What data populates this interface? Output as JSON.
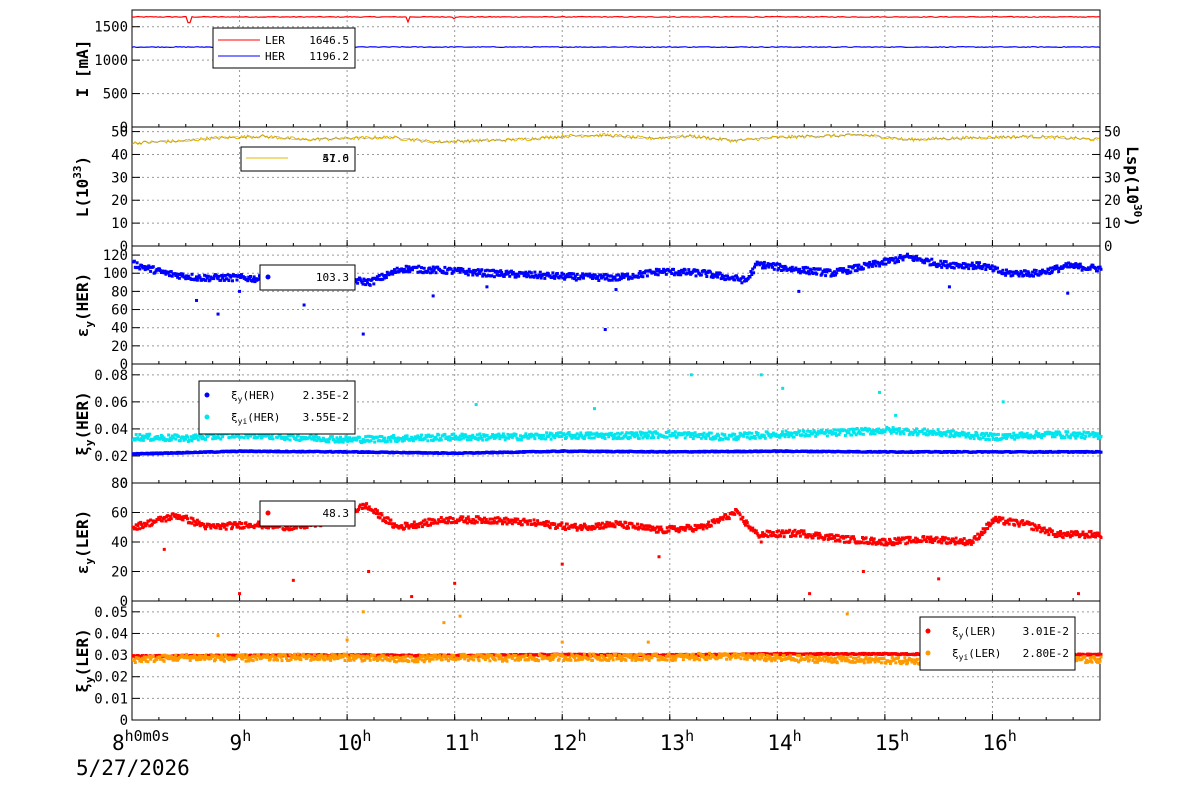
{
  "footer": {
    "date": "5/27/2026"
  },
  "x_axis": {
    "first_label": "8h0m0s",
    "ticks": [
      {
        "t": 8,
        "h": "8",
        "sup": "h0m0s"
      },
      {
        "t": 9,
        "h": "9",
        "sup": "h"
      },
      {
        "t": 10,
        "h": "10",
        "sup": "h"
      },
      {
        "t": 11,
        "h": "11",
        "sup": "h"
      },
      {
        "t": 12,
        "h": "12",
        "sup": "h"
      },
      {
        "t": 13,
        "h": "13",
        "sup": "h"
      },
      {
        "t": 14,
        "h": "14",
        "sup": "h"
      },
      {
        "t": 15,
        "h": "15",
        "sup": "h"
      },
      {
        "t": 16,
        "h": "16",
        "sup": "h"
      }
    ],
    "range_hours": [
      8.0,
      17.0
    ]
  },
  "chart_data": [
    {
      "type": "line",
      "ylabel": "I [mA]",
      "ylim": [
        0,
        1750
      ],
      "yticks": [
        0,
        500,
        1000,
        1500
      ],
      "grid": true,
      "legend_placement": "top-left",
      "series": [
        {
          "name": "LER",
          "value_text": "1646.5",
          "color": "#ff0000",
          "level": 1646.5,
          "dips": [
            {
              "t": 8.53,
              "v": 1560
            },
            {
              "t": 10.56,
              "v": 1570
            },
            {
              "t": 11.0,
              "v": 1620
            }
          ]
        },
        {
          "name": "HER",
          "value_text": "1196.2",
          "color": "#0000ff",
          "level": 1196.2,
          "dips": []
        }
      ]
    },
    {
      "type": "line",
      "ylabel": "L(10^33)",
      "ylabel_right": "Lsp(10^30)",
      "ylim": [
        0,
        52
      ],
      "yticks": [
        0,
        10,
        20,
        30,
        40,
        50
      ],
      "right_ticks": [
        0,
        10,
        20,
        30,
        40,
        50
      ],
      "grid": true,
      "legend_placement": "top-left",
      "legend_overlap_values": [
        "57.0",
        "41.6"
      ],
      "series": [
        {
          "name": "",
          "color": "#e6b800",
          "x": [
            8.0,
            8.5,
            8.7,
            9.2,
            9.6,
            10.0,
            10.4,
            10.8,
            11.2,
            11.6,
            12.0,
            12.4,
            12.8,
            13.2,
            13.6,
            14.0,
            14.4,
            14.8,
            15.2,
            15.6,
            16.0,
            16.4,
            17.0
          ],
          "y": [
            45,
            46,
            47,
            48,
            46.5,
            47,
            47.5,
            45.5,
            46,
            46.5,
            48,
            48.5,
            47,
            48,
            46,
            47.5,
            48,
            48.5,
            46.5,
            47,
            47.5,
            47.8,
            46.5
          ]
        }
      ]
    },
    {
      "type": "scatter",
      "ylabel": "εy(HER)",
      "ylim": [
        0,
        130
      ],
      "yticks": [
        0,
        20,
        40,
        60,
        80,
        100,
        120
      ],
      "grid": true,
      "legend_placement": "top-left",
      "legend_value": "103.3",
      "series": [
        {
          "name": "",
          "color": "#0000ff",
          "x": [
            8.0,
            8.3,
            8.6,
            9.0,
            9.4,
            9.8,
            10.2,
            10.5,
            10.9,
            11.3,
            11.7,
            12.1,
            12.5,
            12.9,
            13.3,
            13.7,
            13.8,
            14.1,
            14.5,
            14.9,
            15.2,
            15.5,
            15.9,
            16.1,
            16.4,
            16.7,
            17.0
          ],
          "y": [
            110,
            100,
            95,
            95,
            92,
            96,
            90,
            105,
            103,
            100,
            98,
            96,
            95,
            102,
            100,
            92,
            110,
            105,
            100,
            110,
            118,
            110,
            108,
            100,
            100,
            108,
            105
          ],
          "outliers_x": [
            8.6,
            8.8,
            9.0,
            9.6,
            10.15,
            10.8,
            11.3,
            12.4,
            12.5,
            14.2,
            15.6,
            16.7
          ],
          "outliers_y": [
            70,
            55,
            80,
            65,
            33,
            75,
            85,
            38,
            82,
            80,
            85,
            78
          ]
        }
      ]
    },
    {
      "type": "scatter",
      "ylabel": "ξy(HER)",
      "ylim": [
        0,
        0.088
      ],
      "yticks": [
        0,
        0.02,
        0.04,
        0.06,
        0.08
      ],
      "ytick_labels": [
        "0",
        "0.02",
        "0.04",
        "0.06",
        "0.08"
      ],
      "grid": true,
      "legend_placement": "top-left",
      "series": [
        {
          "name": "ξy(HER)",
          "value_text": "2.35E-2",
          "color": "#0000ff",
          "x": [
            8.0,
            9.0,
            10.0,
            11.0,
            12.0,
            13.0,
            14.0,
            15.0,
            16.0,
            17.0
          ],
          "y": [
            0.0215,
            0.0235,
            0.023,
            0.022,
            0.0235,
            0.023,
            0.0235,
            0.023,
            0.023,
            0.023
          ]
        },
        {
          "name": "ξyi(HER)",
          "value_text": "3.55E-2",
          "color": "#00e5ee",
          "x": [
            8.0,
            8.5,
            9.0,
            9.5,
            10.0,
            10.5,
            11.0,
            11.5,
            12.0,
            12.5,
            13.0,
            13.5,
            14.0,
            14.5,
            15.0,
            15.5,
            16.0,
            16.5,
            17.0
          ],
          "y": [
            0.034,
            0.033,
            0.036,
            0.034,
            0.032,
            0.033,
            0.034,
            0.034,
            0.035,
            0.035,
            0.036,
            0.034,
            0.036,
            0.037,
            0.039,
            0.037,
            0.034,
            0.036,
            0.035
          ],
          "outliers_x": [
            10.0,
            11.2,
            12.3,
            13.2,
            13.85,
            14.05,
            14.95,
            15.1,
            16.1
          ],
          "outliers_y": [
            0.057,
            0.058,
            0.055,
            0.08,
            0.08,
            0.07,
            0.067,
            0.05,
            0.06
          ]
        }
      ]
    },
    {
      "type": "scatter",
      "ylabel": "εy(LER)",
      "ylim": [
        0,
        80
      ],
      "yticks": [
        0,
        20,
        40,
        60,
        80
      ],
      "grid": true,
      "legend_placement": "top-left",
      "legend_value": "48.3",
      "series": [
        {
          "name": "",
          "color": "#ff0000",
          "x": [
            8.0,
            8.4,
            8.7,
            9.1,
            9.5,
            9.9,
            10.15,
            10.45,
            10.9,
            11.3,
            11.7,
            12.1,
            12.5,
            12.9,
            13.3,
            13.6,
            13.8,
            14.2,
            14.6,
            15.0,
            15.4,
            15.8,
            16.0,
            16.3,
            16.6,
            17.0
          ],
          "y": [
            50,
            58,
            50,
            52,
            50,
            55,
            65,
            50,
            55,
            55,
            53,
            50,
            52,
            48,
            50,
            60,
            45,
            46,
            42,
            40,
            42,
            40,
            55,
            52,
            45,
            45
          ],
          "outliers_x": [
            8.3,
            9.0,
            9.5,
            10.2,
            10.6,
            11.0,
            12.0,
            12.9,
            13.85,
            14.3,
            14.8,
            15.5,
            16.8
          ],
          "outliers_y": [
            35,
            5,
            14,
            20,
            3,
            12,
            25,
            30,
            40,
            5,
            20,
            15,
            5
          ]
        }
      ]
    },
    {
      "type": "scatter",
      "ylabel": "ξy(LER)",
      "ylim": [
        0,
        0.055
      ],
      "yticks": [
        0,
        0.01,
        0.02,
        0.03,
        0.04,
        0.05
      ],
      "ytick_labels": [
        "0",
        "0.01",
        "0.02",
        "0.03",
        "0.04",
        "0.05"
      ],
      "grid": true,
      "legend_placement": "top-right",
      "series": [
        {
          "name": "ξy(LER)",
          "value_text": "3.01E-2",
          "color": "#ff0000",
          "x": [
            8.0,
            9.0,
            10.0,
            11.0,
            12.0,
            13.0,
            14.0,
            15.0,
            16.0,
            17.0
          ],
          "y": [
            0.0295,
            0.0298,
            0.03,
            0.0298,
            0.0302,
            0.03,
            0.0305,
            0.0305,
            0.0302,
            0.0302
          ]
        },
        {
          "name": "ξyi(LER)",
          "value_text": "2.80E-2",
          "color": "#ff9900",
          "x": [
            8.0,
            8.5,
            9.0,
            9.5,
            10.0,
            10.5,
            11.0,
            11.5,
            12.0,
            12.5,
            13.0,
            13.5,
            14.0,
            14.5,
            15.0,
            15.5,
            16.0,
            16.5,
            17.0
          ],
          "y": [
            0.028,
            0.029,
            0.0285,
            0.029,
            0.029,
            0.028,
            0.029,
            0.0285,
            0.029,
            0.029,
            0.029,
            0.0295,
            0.0285,
            0.028,
            0.0275,
            0.027,
            0.0285,
            0.0275,
            0.028
          ],
          "outliers_x": [
            8.8,
            10.0,
            10.15,
            10.9,
            11.05,
            12.0,
            12.8,
            14.65
          ],
          "outliers_y": [
            0.039,
            0.037,
            0.05,
            0.045,
            0.048,
            0.036,
            0.036,
            0.049
          ]
        }
      ]
    }
  ]
}
